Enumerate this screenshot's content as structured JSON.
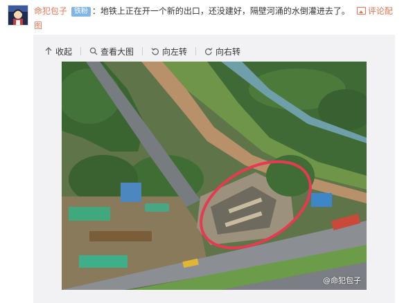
{
  "post": {
    "username": "命犯包子",
    "badge": "铁粉",
    "text": "：地铁上正在开一个新的出口，还没建好，隔壁河涌的水倒灌进去了。",
    "comment_pic_label": "评论配图"
  },
  "toolbar": {
    "collapse": "收起",
    "view_large": "查看大图",
    "rotate_left": "向左转",
    "rotate_right": "向右转"
  },
  "image": {
    "watermark": "@命犯包子"
  },
  "icons": {
    "collapse": "arrow-up-icon",
    "view_large": "magnifier-icon",
    "rotate_left": "rotate-left-icon",
    "rotate_right": "rotate-right-icon",
    "comment_pic": "picture-icon"
  },
  "colors": {
    "link_orange": "#eb7350",
    "badge_blue": "#7fb5e8",
    "media_bg": "#f2f2f5",
    "annotation_red": "#e53a52"
  }
}
